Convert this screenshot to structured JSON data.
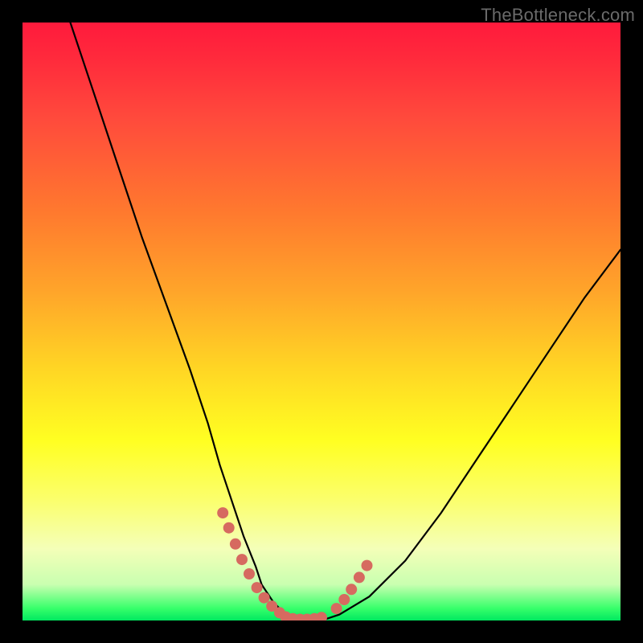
{
  "watermark": {
    "text": "TheBottleneck.com"
  },
  "colors": {
    "curve_stroke": "#000000",
    "marker_fill": "#d66a60",
    "bg_black": "#000000"
  },
  "chart_data": {
    "type": "line",
    "title": "",
    "xlabel": "",
    "ylabel": "",
    "xlim": [
      0,
      100
    ],
    "ylim": [
      0,
      100
    ],
    "grid": false,
    "legend": false,
    "series": [
      {
        "name": "bottleneck-curve",
        "x_pct": [
          8,
          12,
          16,
          20,
          24,
          28,
          31,
          33,
          35,
          37,
          39,
          40,
          42,
          44,
          46,
          48,
          50,
          53,
          58,
          64,
          70,
          76,
          82,
          88,
          94,
          100
        ],
        "y_pct": [
          100,
          88,
          76,
          64,
          53,
          42,
          33,
          26,
          20,
          14,
          9,
          6,
          3,
          1,
          0,
          0,
          0,
          1,
          4,
          10,
          18,
          27,
          36,
          45,
          54,
          62
        ]
      }
    ],
    "markers": {
      "left_segment": {
        "x_pct": [
          33.5,
          34.5,
          35.6,
          36.7,
          37.9,
          39.2,
          40.4,
          41.7,
          43.0
        ],
        "y_pct": [
          18.0,
          15.5,
          12.8,
          10.2,
          7.8,
          5.5,
          3.8,
          2.4,
          1.3
        ]
      },
      "bottom_segment": {
        "x_pct": [
          44.0,
          45.2,
          46.4,
          47.6,
          48.8,
          50.0
        ],
        "y_pct": [
          0.6,
          0.3,
          0.2,
          0.2,
          0.3,
          0.5
        ]
      },
      "right_segment": {
        "x_pct": [
          52.5,
          53.8,
          55.0,
          56.3,
          57.6
        ],
        "y_pct": [
          2.0,
          3.5,
          5.2,
          7.2,
          9.2
        ]
      }
    }
  }
}
